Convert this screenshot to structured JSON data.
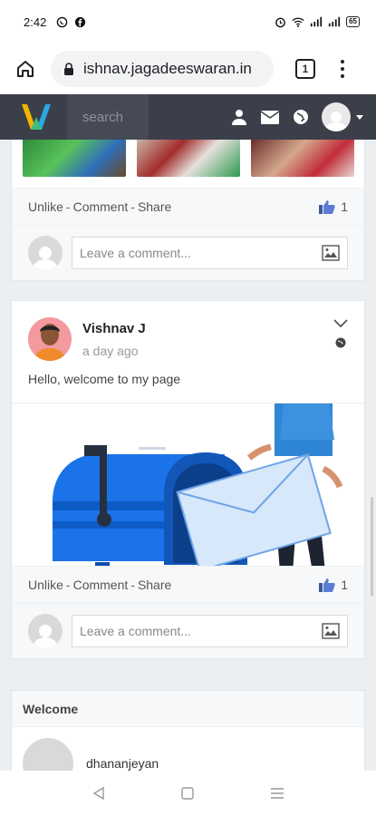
{
  "status_bar": {
    "time": "2:42",
    "battery": "65"
  },
  "browser": {
    "url": "ishnav.jagadeeswaran.in",
    "tab_count": "1"
  },
  "navbar": {
    "search_placeholder": "search"
  },
  "post1": {
    "actions": {
      "unlike": "Unlike",
      "comment": "Comment",
      "share": "Share",
      "sep": "-"
    },
    "like_count": "1",
    "comment_placeholder": "Leave a comment..."
  },
  "post2": {
    "author": "Vishnav J",
    "time_ago": "a day ago",
    "text": "Hello, welcome to my page",
    "actions": {
      "unlike": "Unlike",
      "comment": "Comment",
      "share": "Share",
      "sep": "-"
    },
    "like_count": "1",
    "comment_placeholder": "Leave a comment..."
  },
  "welcome_widget": {
    "title": "Welcome",
    "user_name": "dhananjeyan"
  },
  "colors": {
    "navbar": "#3a3f4a",
    "accent_blue": "#1a73e8",
    "logo_yellow": "#f5b400",
    "logo_blue": "#2aa8e0"
  }
}
